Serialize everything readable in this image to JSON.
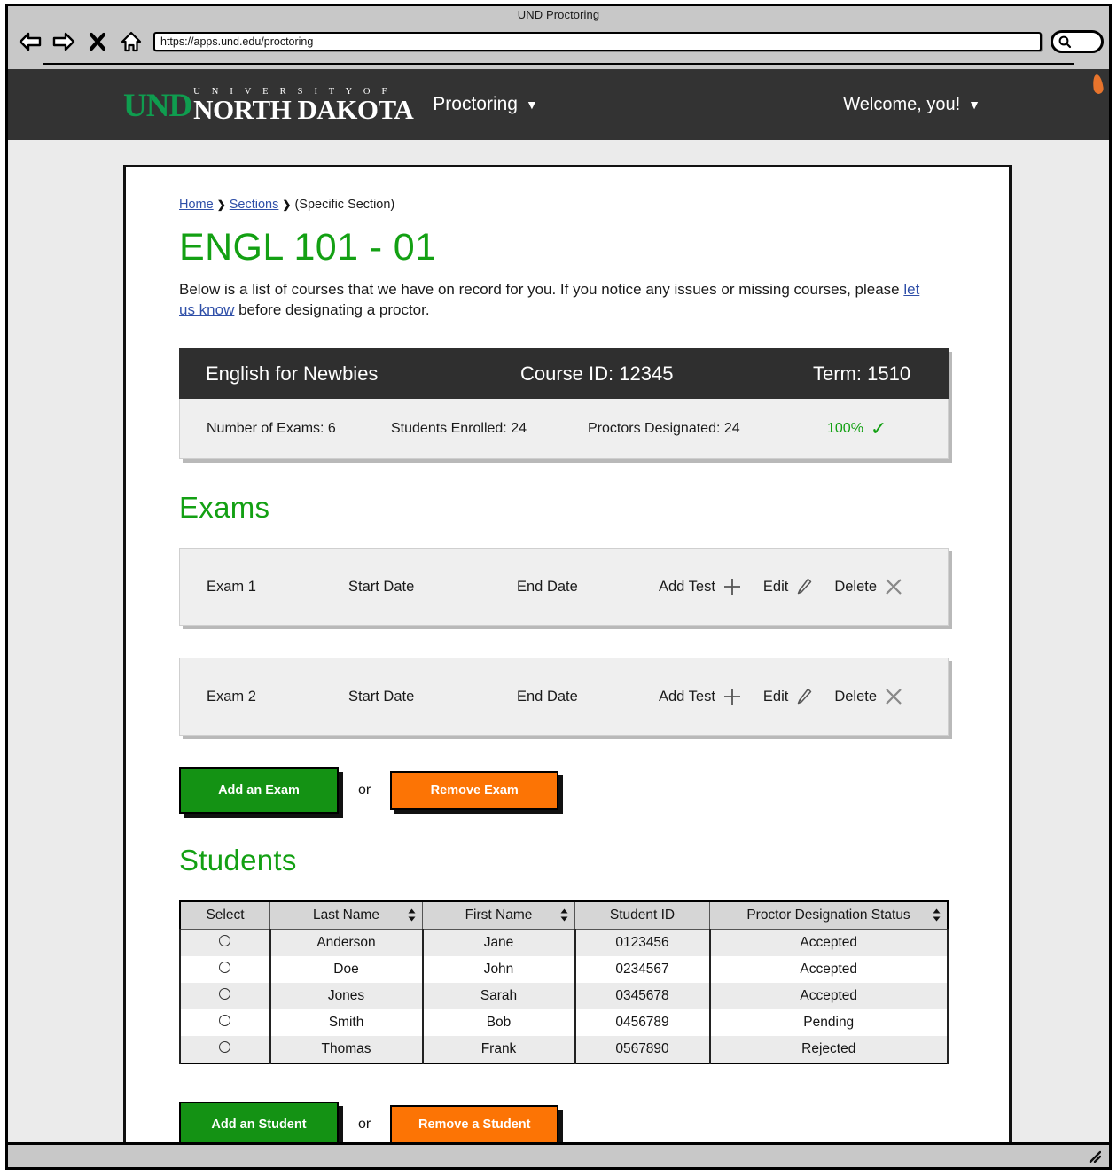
{
  "browser": {
    "title": "UND Proctoring",
    "url": "https://apps.und.edu/proctoring",
    "back_icon": "back-arrow-icon",
    "forward_icon": "forward-arrow-icon",
    "stop_icon": "close-x-icon",
    "home_icon": "home-icon",
    "search_icon": "search-icon"
  },
  "navbar": {
    "logo_und": "UND",
    "logo_university_of": "U N I V E R S I T Y   O F",
    "logo_north_dakota": "NORTH DAKOTA",
    "menu_label": "Proctoring",
    "menu_caret": "▼",
    "welcome_label": "Welcome, you!",
    "welcome_caret": "▼"
  },
  "breadcrumb": {
    "home": "Home",
    "sections": "Sections",
    "separator": "❯",
    "current": "(Specific Section)"
  },
  "page": {
    "title": "ENGL 101 - 01",
    "intro_part1": "Below is a list of courses that we have on record for you. If you notice any issues or missing courses, please ",
    "intro_link": "let us know",
    "intro_part2": " before designating a proctor."
  },
  "course": {
    "name": "English for Newbies",
    "course_id": "Course ID: 12345",
    "term": "Term: 1510",
    "number_of_exams": "Number of Exams: 6",
    "students_enrolled": "Students Enrolled: 24",
    "proctors_designated": "Proctors Designated: 24",
    "percent": "100%",
    "check_glyph": "✓"
  },
  "exams_section": {
    "heading": "Exams",
    "rows": [
      {
        "name": "Exam 1",
        "start_date": "Start Date",
        "end_date": "End Date",
        "add_test": "Add Test",
        "edit": "Edit",
        "delete": "Delete"
      },
      {
        "name": "Exam 2",
        "start_date": "Start Date",
        "end_date": "End Date",
        "add_test": "Add Test",
        "edit": "Edit",
        "delete": "Delete"
      }
    ],
    "add_button": "Add an Exam",
    "or_label": "or",
    "remove_button": "Remove Exam"
  },
  "students_section": {
    "heading": "Students",
    "columns": [
      "Select",
      "Last Name",
      "First Name",
      "Student ID",
      "Proctor Designation Status"
    ],
    "sort_glyph": "▲▼",
    "rows": [
      {
        "last": "Anderson",
        "first": "Jane",
        "sid": "0123456",
        "status": "Accepted"
      },
      {
        "last": "Doe",
        "first": "John",
        "sid": "0234567",
        "status": "Accepted"
      },
      {
        "last": "Jones",
        "first": "Sarah",
        "sid": "0345678",
        "status": "Accepted"
      },
      {
        "last": "Smith",
        "first": "Bob",
        "sid": "0456789",
        "status": "Pending"
      },
      {
        "last": "Thomas",
        "first": "Frank",
        "sid": "0567890",
        "status": "Rejected"
      }
    ],
    "add_button": "Add an Student",
    "or_label": "or",
    "remove_button": "Remove a Student"
  },
  "colors": {
    "brand_green": "#13a013",
    "button_green": "#149214",
    "button_orange": "#fc7405",
    "navbar_dark": "#333333",
    "link_blue": "#2f4fa8"
  }
}
